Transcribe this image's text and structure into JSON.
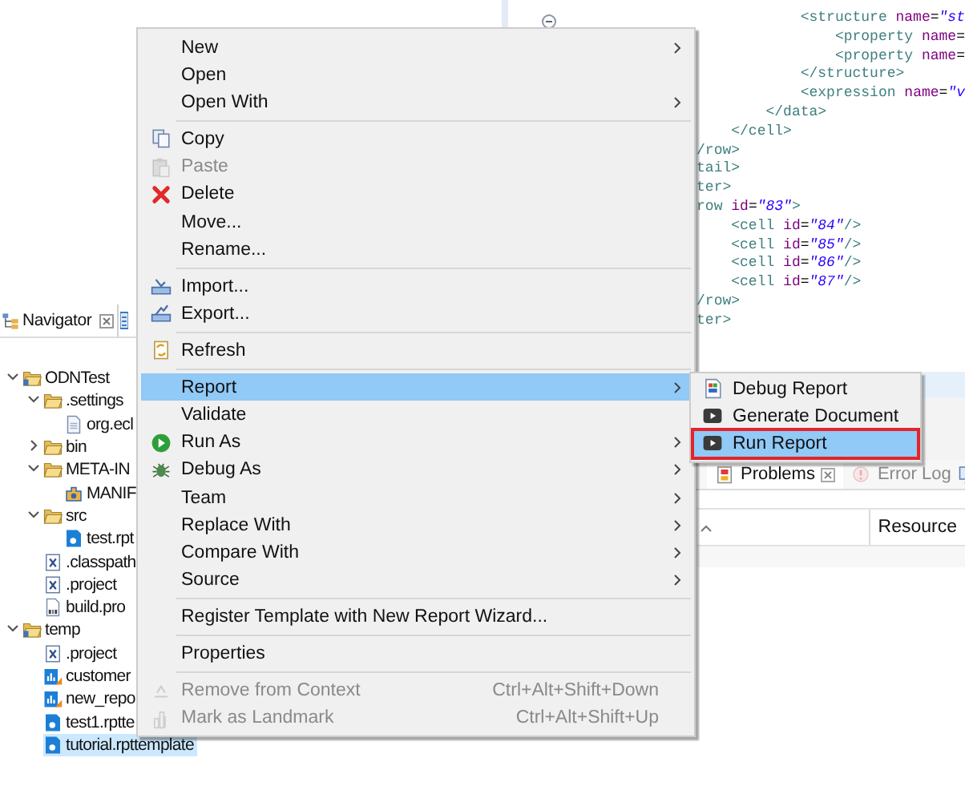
{
  "navigator": {
    "tab": {
      "label": "Navigator"
    },
    "tree": [
      {
        "label": "ODNTest",
        "kind": "project",
        "expanded": true,
        "selected": false,
        "children": [
          {
            "label": ".settings",
            "kind": "folder",
            "expanded": true,
            "selected": false,
            "children": [
              {
                "label": "org.ecl",
                "kind": "file",
                "selected": false
              }
            ]
          },
          {
            "label": "bin",
            "kind": "folder",
            "expanded": false,
            "selected": false
          },
          {
            "label": "META-IN",
            "kind": "folder",
            "expanded": true,
            "selected": false,
            "children": [
              {
                "label": "MANIF",
                "kind": "manifest",
                "selected": false
              }
            ]
          },
          {
            "label": "src",
            "kind": "folder",
            "expanded": true,
            "selected": false,
            "children": [
              {
                "label": "test.rpt",
                "kind": "template",
                "selected": false
              }
            ]
          },
          {
            "label": ".classpath",
            "kind": "xml",
            "selected": false
          },
          {
            "label": ".project",
            "kind": "xml",
            "selected": false
          },
          {
            "label": "build.pro",
            "kind": "properties",
            "selected": false
          }
        ]
      },
      {
        "label": "temp",
        "kind": "project",
        "expanded": true,
        "selected": false,
        "children": [
          {
            "label": ".project",
            "kind": "xml",
            "selected": false
          },
          {
            "label": "customer",
            "kind": "report",
            "selected": false
          },
          {
            "label": "new_repo",
            "kind": "report",
            "selected": false
          },
          {
            "label": "test1.rptte",
            "kind": "template",
            "selected": false
          },
          {
            "label": "tutorial.rpttemplate",
            "kind": "template",
            "selected": true
          }
        ]
      }
    ]
  },
  "editor": {
    "lines": [
      {
        "tokens": [
          {
            "kind": "tag",
            "text": "            <structure"
          },
          {
            "kind": "attr",
            "text": " name"
          },
          {
            "kind": "plain",
            "text": "="
          },
          {
            "kind": "value",
            "text": "\"st"
          }
        ]
      },
      {
        "tokens": [
          {
            "kind": "tag",
            "text": "                <property"
          },
          {
            "kind": "attr",
            "text": " name"
          },
          {
            "kind": "plain",
            "text": "="
          }
        ]
      },
      {
        "tokens": [
          {
            "kind": "tag",
            "text": "                <property"
          },
          {
            "kind": "attr",
            "text": " name"
          },
          {
            "kind": "plain",
            "text": "="
          }
        ]
      },
      {
        "tokens": [
          {
            "kind": "tag",
            "text": "            </structure>"
          }
        ]
      },
      {
        "tokens": [
          {
            "kind": "tag",
            "text": "            <expression"
          },
          {
            "kind": "attr",
            "text": " name"
          },
          {
            "kind": "plain",
            "text": "="
          },
          {
            "kind": "value",
            "text": "\"v"
          }
        ]
      },
      {
        "tokens": [
          {
            "kind": "tag",
            "text": "        </data>"
          }
        ]
      },
      {
        "tokens": [
          {
            "kind": "tag",
            "text": "    </cell>"
          }
        ]
      },
      {
        "tokens": [
          {
            "kind": "tag",
            "text": "/row>"
          }
        ]
      },
      {
        "tokens": [
          {
            "kind": "tag",
            "text": "tail>"
          }
        ]
      },
      {
        "tokens": [
          {
            "kind": "tag",
            "text": "ter>"
          }
        ]
      },
      {
        "tokens": [
          {
            "kind": "tag",
            "text": "row"
          },
          {
            "kind": "attr",
            "text": " id"
          },
          {
            "kind": "plain",
            "text": "="
          },
          {
            "kind": "value",
            "text": "\"83\""
          },
          {
            "kind": "tag",
            "text": ">"
          }
        ]
      },
      {
        "tokens": [
          {
            "kind": "tag",
            "text": "    <cell"
          },
          {
            "kind": "attr",
            "text": " id"
          },
          {
            "kind": "plain",
            "text": "="
          },
          {
            "kind": "value",
            "text": "\"84\""
          },
          {
            "kind": "tag",
            "text": "/>"
          }
        ]
      },
      {
        "tokens": [
          {
            "kind": "tag",
            "text": "    <cell"
          },
          {
            "kind": "attr",
            "text": " id"
          },
          {
            "kind": "plain",
            "text": "="
          },
          {
            "kind": "value",
            "text": "\"85\""
          },
          {
            "kind": "tag",
            "text": "/>"
          }
        ]
      },
      {
        "tokens": [
          {
            "kind": "tag",
            "text": "    <cell"
          },
          {
            "kind": "attr",
            "text": " id"
          },
          {
            "kind": "plain",
            "text": "="
          },
          {
            "kind": "value",
            "text": "\"86\""
          },
          {
            "kind": "tag",
            "text": "/>"
          }
        ]
      },
      {
        "tokens": [
          {
            "kind": "tag",
            "text": "    <cell"
          },
          {
            "kind": "attr",
            "text": " id"
          },
          {
            "kind": "plain",
            "text": "="
          },
          {
            "kind": "value",
            "text": "\"87\""
          },
          {
            "kind": "tag",
            "text": "/>"
          }
        ]
      },
      {
        "tokens": [
          {
            "kind": "tag",
            "text": "/row>"
          }
        ]
      },
      {
        "tokens": [
          {
            "kind": "tag",
            "text": "ter>"
          }
        ]
      }
    ]
  },
  "context_menu": {
    "items": [
      {
        "kind": "item",
        "label": "New",
        "submenu": true,
        "disabled": false,
        "selected": false
      },
      {
        "kind": "item",
        "label": "Open",
        "submenu": false,
        "disabled": false,
        "selected": false
      },
      {
        "kind": "item",
        "label": "Open With",
        "submenu": true,
        "disabled": false,
        "selected": false
      },
      {
        "kind": "separator"
      },
      {
        "kind": "item",
        "label": "Copy",
        "submenu": false,
        "disabled": false,
        "selected": false
      },
      {
        "kind": "item",
        "label": "Paste",
        "submenu": false,
        "disabled": true,
        "selected": false
      },
      {
        "kind": "item",
        "label": "Delete",
        "submenu": false,
        "disabled": false,
        "selected": false
      },
      {
        "kind": "item",
        "label": "Move...",
        "submenu": false,
        "disabled": false,
        "selected": false
      },
      {
        "kind": "item",
        "label": "Rename...",
        "submenu": false,
        "disabled": false,
        "selected": false
      },
      {
        "kind": "separator"
      },
      {
        "kind": "item",
        "label": "Import...",
        "submenu": false,
        "disabled": false,
        "selected": false
      },
      {
        "kind": "item",
        "label": "Export...",
        "submenu": false,
        "disabled": false,
        "selected": false
      },
      {
        "kind": "separator"
      },
      {
        "kind": "item",
        "label": "Refresh",
        "submenu": false,
        "disabled": false,
        "selected": false
      },
      {
        "kind": "separator"
      },
      {
        "kind": "item",
        "label": "Report",
        "submenu": true,
        "disabled": false,
        "selected": true
      },
      {
        "kind": "item",
        "label": "Validate",
        "submenu": false,
        "disabled": false,
        "selected": false
      },
      {
        "kind": "item",
        "label": "Run As",
        "submenu": true,
        "disabled": false,
        "selected": false
      },
      {
        "kind": "item",
        "label": "Debug As",
        "submenu": true,
        "disabled": false,
        "selected": false
      },
      {
        "kind": "item",
        "label": "Team",
        "submenu": true,
        "disabled": false,
        "selected": false
      },
      {
        "kind": "item",
        "label": "Replace With",
        "submenu": true,
        "disabled": false,
        "selected": false
      },
      {
        "kind": "item",
        "label": "Compare With",
        "submenu": true,
        "disabled": false,
        "selected": false
      },
      {
        "kind": "item",
        "label": "Source",
        "submenu": true,
        "disabled": false,
        "selected": false
      },
      {
        "kind": "separator"
      },
      {
        "kind": "item",
        "label": "Register Template with New Report Wizard...",
        "submenu": false,
        "disabled": false,
        "selected": false
      },
      {
        "kind": "separator"
      },
      {
        "kind": "item",
        "label": "Properties",
        "submenu": false,
        "disabled": false,
        "selected": false
      },
      {
        "kind": "separator"
      },
      {
        "kind": "item",
        "label": "Remove from Context",
        "shortcut": "Ctrl+Alt+Shift+Down",
        "submenu": false,
        "disabled": true,
        "selected": false
      },
      {
        "kind": "item",
        "label": "Mark as Landmark",
        "shortcut": "Ctrl+Alt+Shift+Up",
        "submenu": false,
        "disabled": true,
        "selected": false
      }
    ]
  },
  "report_submenu": {
    "items": [
      {
        "label": "Debug Report",
        "selected": false,
        "outlined": false
      },
      {
        "label": "Generate Document",
        "selected": false,
        "outlined": false
      },
      {
        "label": "Run Report",
        "selected": true,
        "outlined": true
      }
    ]
  },
  "problems_panel": {
    "tabs": [
      {
        "label": "Problems",
        "selected": true
      },
      {
        "label": "Error Log",
        "selected": false
      }
    ],
    "columns": [
      "Resource"
    ]
  }
}
